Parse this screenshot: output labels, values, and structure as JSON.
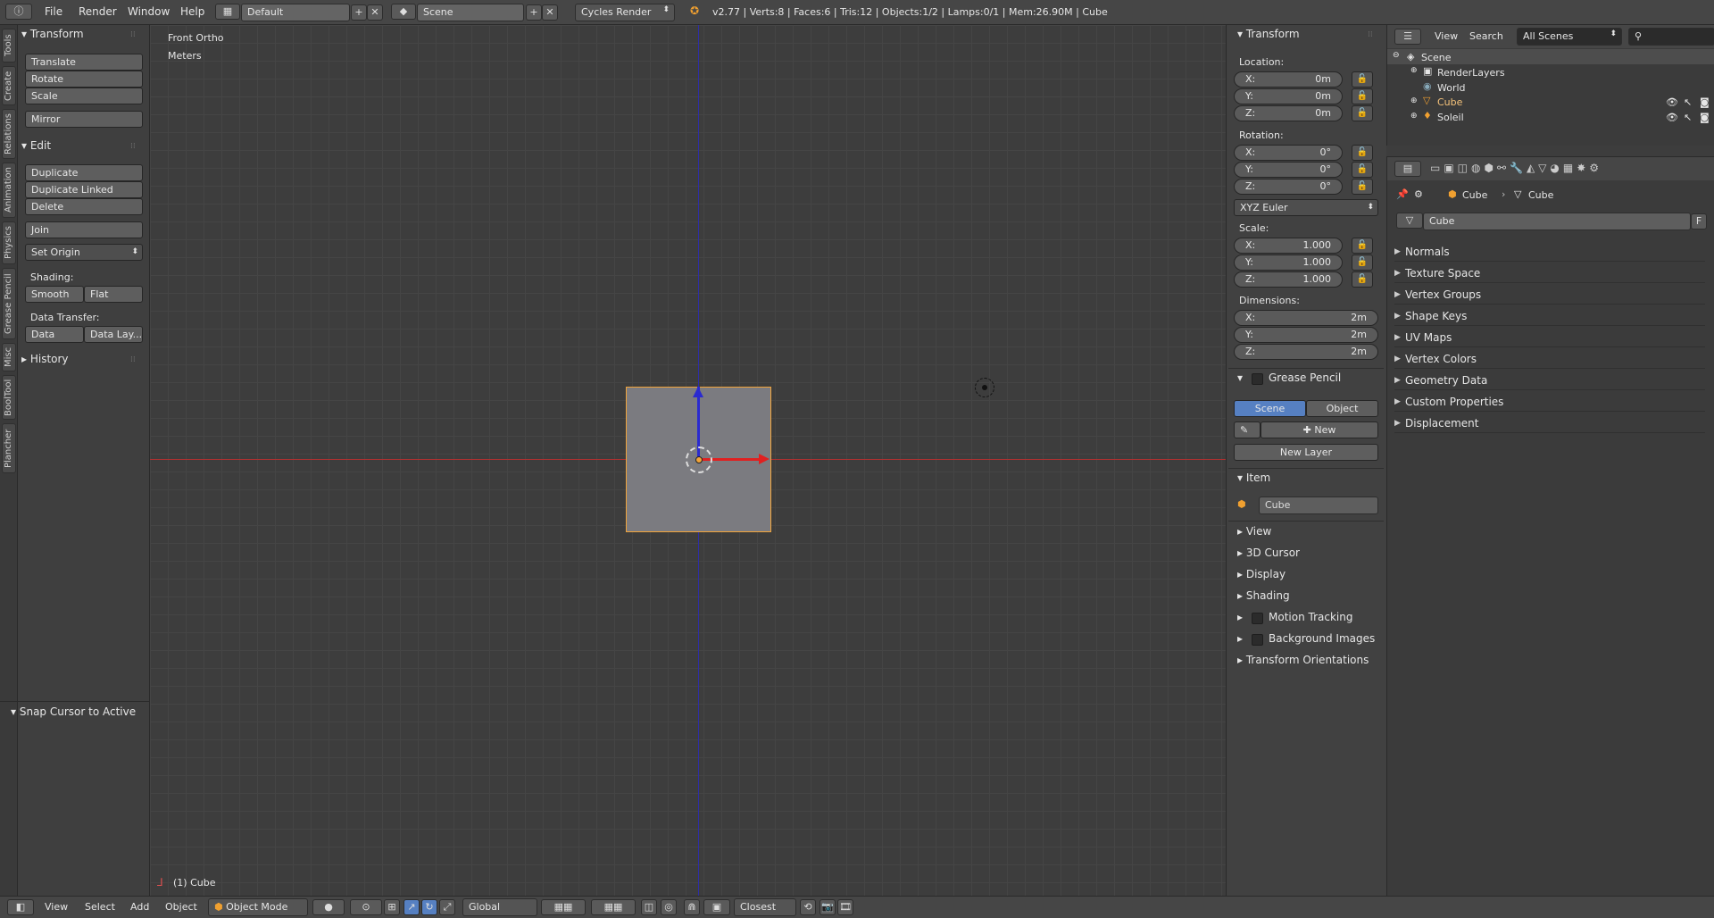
{
  "topbar": {
    "menus": [
      "File",
      "Render",
      "Window",
      "Help"
    ],
    "layout": "Default",
    "scene": "Scene",
    "engine": "Cycles Render",
    "stats": "v2.77 | Verts:8 | Faces:6 | Tris:12 | Objects:1/2 | Lamps:0/1 | Mem:26.90M | Cube"
  },
  "tool_tabs": [
    "Tools",
    "Create",
    "Relations",
    "Animation",
    "Physics",
    "Grease Pencil",
    "Misc",
    "BoolTool",
    "Plancher"
  ],
  "left": {
    "transform_title": "Transform",
    "translate": "Translate",
    "rotate": "Rotate",
    "scale": "Scale",
    "mirror": "Mirror",
    "edit_title": "Edit",
    "duplicate": "Duplicate",
    "duplicate_linked": "Duplicate Linked",
    "delete": "Delete",
    "join": "Join",
    "set_origin": "Set Origin",
    "shading_label": "Shading:",
    "smooth": "Smooth",
    "flat": "Flat",
    "data_transfer_label": "Data Transfer:",
    "data": "Data",
    "data_layout": "Data Lay...",
    "history": "History",
    "snap": "Snap Cursor to Active"
  },
  "viewport": {
    "view_name": "Front Ortho",
    "units": "Meters",
    "object_label": "(1) Cube"
  },
  "npanel": {
    "transform": "Transform",
    "location": "Location:",
    "loc": {
      "x": "0m",
      "y": "0m",
      "z": "0m"
    },
    "rotation": "Rotation:",
    "rot": {
      "x": "0°",
      "y": "0°",
      "z": "0°"
    },
    "rot_mode": "XYZ Euler",
    "scale_label": "Scale:",
    "scl": {
      "x": "1.000",
      "y": "1.000",
      "z": "1.000"
    },
    "dimensions": "Dimensions:",
    "dim": {
      "x": "2m",
      "y": "2m",
      "z": "2m"
    },
    "axis": {
      "x": "X:",
      "y": "Y:",
      "z": "Z:"
    },
    "grease_pencil": "Grease Pencil",
    "gp_scene": "Scene",
    "gp_object": "Object",
    "gp_new": "New",
    "gp_new_layer": "New Layer",
    "item": "Item",
    "item_name": "Cube",
    "view": "View",
    "cursor3d": "3D Cursor",
    "display": "Display",
    "shading": "Shading",
    "motion_tracking": "Motion Tracking",
    "background_images": "Background Images",
    "transform_orientations": "Transform Orientations"
  },
  "outliner": {
    "view": "View",
    "search": "Search",
    "filter": "All Scenes",
    "items": [
      "Scene",
      "RenderLayers",
      "World",
      "Cube",
      "Soleil"
    ]
  },
  "props": {
    "breadcrumb_obj": "Cube",
    "breadcrumb_data": "Cube",
    "mesh_name": "Cube",
    "fake_user": "F",
    "panels": [
      "Normals",
      "Texture Space",
      "Vertex Groups",
      "Shape Keys",
      "UV Maps",
      "Vertex Colors",
      "Geometry Data",
      "Custom Properties",
      "Displacement"
    ]
  },
  "bottombar": {
    "menus": [
      "View",
      "Select",
      "Add",
      "Object"
    ],
    "mode": "Object Mode",
    "orientation": "Global",
    "snap_target": "Closest"
  },
  "colors": {
    "accent": "#5680c2",
    "selection": "#f1a43a"
  }
}
